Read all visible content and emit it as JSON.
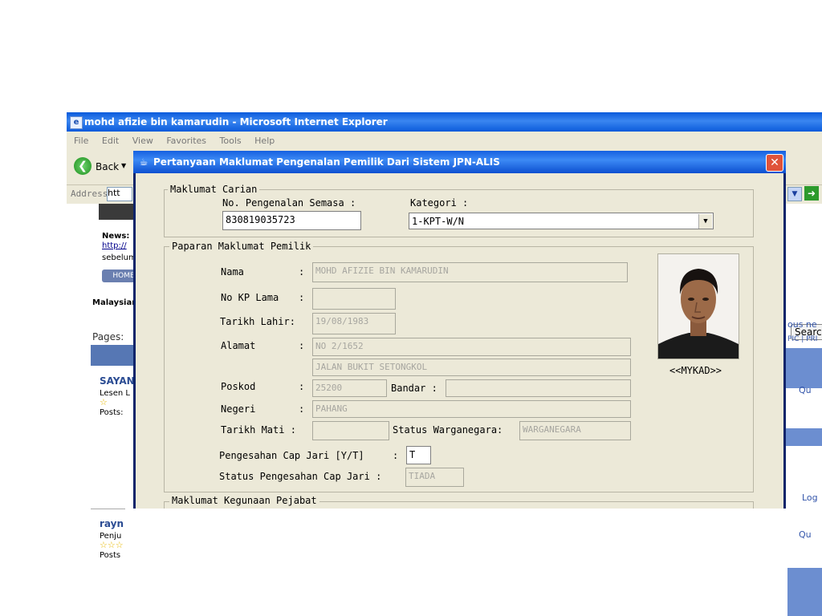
{
  "browser": {
    "title": "mohd afizie bin kamarudin - Microsoft Internet Explorer",
    "menu": [
      "File",
      "Edit",
      "View",
      "Favorites",
      "Tools",
      "Help"
    ],
    "back_label": "Back",
    "address_label": "Address",
    "address_value": "htt",
    "page": {
      "news_label": "News:",
      "news_link": "http://",
      "news_text": "sebelum",
      "home_tab": "HOME",
      "malaysia_text": "Malaysian",
      "pages_label": "Pages:",
      "post1_name": "SAYAN",
      "post1_sub": "Lesen L",
      "post1_posts": "Posts:",
      "post2_name": "rayn",
      "post2_sub": "Penju",
      "post2_posts": "Posts",
      "right_search": "Searc",
      "right_text1": "ous ne",
      "right_text2": "PIC | PRI",
      "right_quote1": "Qu",
      "right_log": "Log",
      "right_quote2": "Qu"
    }
  },
  "dialog": {
    "title": "Pertanyaan Maklumat Pengenalan Pemilik Dari Sistem JPN-ALIS",
    "group_search": {
      "legend": "Maklumat Carian",
      "ic_label": "No. Pengenalan Semasa :",
      "ic_value": "830819035723",
      "category_label": "Kategori :",
      "category_value": "1-KPT-W/N"
    },
    "group_owner": {
      "legend": "Paparan Maklumat Pemilik",
      "name_label": "Nama",
      "name_value": "MOHD AFIZIE BIN KAMARUDIN",
      "old_ic_label": "No KP Lama",
      "old_ic_value": "",
      "dob_label": "Tarikh Lahir:",
      "dob_value": "19/08/1983",
      "address_label": "Alamat",
      "address_line1": "NO 2/1652",
      "address_line2": "JALAN BUKIT SETONGKOL",
      "postcode_label": "Poskod",
      "postcode_value": "25200",
      "city_label": "Bandar :",
      "city_value": "",
      "state_label": "Negeri",
      "state_value": "PAHANG",
      "death_label": "Tarikh Mati :",
      "death_value": "",
      "citizen_label": "Status Warganegara:",
      "citizen_value": "WARGANEGARA",
      "fp_label": "Pengesahan Cap Jari [Y/T]",
      "fp_value": "T",
      "fp_status_label": "Status Pengesahan Cap Jari :",
      "fp_status_value": "TIADA",
      "colon": ":",
      "photo_caption": "<<MYKAD>>"
    },
    "group_office": {
      "legend": "Maklumat Kegunaan Pejabat"
    }
  }
}
